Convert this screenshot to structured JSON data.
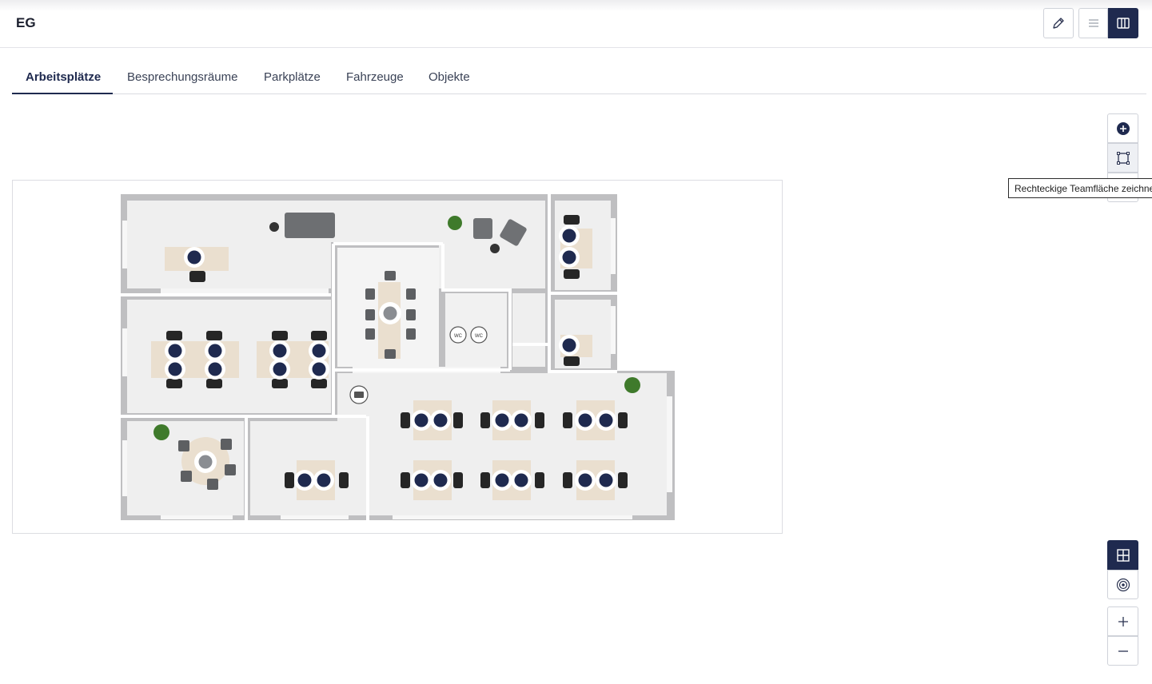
{
  "header": {
    "title": "EG"
  },
  "tabs": [
    {
      "label": "Arbeitsplätze",
      "active": true
    },
    {
      "label": "Besprechungsräume"
    },
    {
      "label": "Parkplätze"
    },
    {
      "label": "Fahrzeuge"
    },
    {
      "label": "Objekte"
    }
  ],
  "toolbar": {
    "edit_icon": "pencil-icon",
    "list_icon": "list-icon",
    "map_icon": "map-icon"
  },
  "map_controls": {
    "add_icon": "plus-circle-icon",
    "draw_rect_icon": "rectangle-draw-icon",
    "tooltip": "Rechteckige Teamfläche zeichnen",
    "grid_icon": "grid-icon",
    "target_icon": "target-icon",
    "zoom_in_icon": "zoom-in-icon",
    "zoom_out_icon": "zoom-out-icon"
  },
  "floorplan": {
    "wc_labels": [
      "WC",
      "WC"
    ]
  },
  "colors": {
    "accent": "#1f2a4f",
    "desk_marker": "#1f2a4f",
    "desk_marker_ring": "#ffffff",
    "room_marker": "#8a8d92"
  }
}
